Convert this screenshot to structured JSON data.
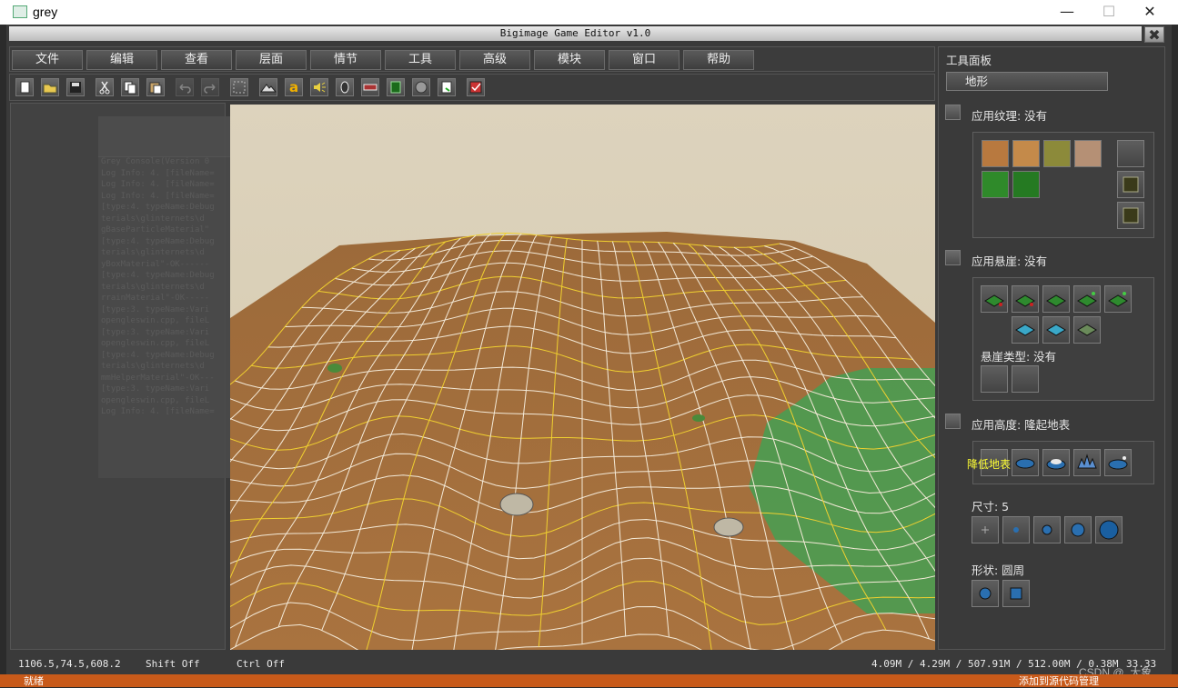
{
  "os_window": {
    "title": "grey",
    "minimize_glyph": "—",
    "maximize_glyph": "☐",
    "close_glyph": "✕"
  },
  "app": {
    "title": "Bigimage Game Editor v1.0",
    "close_glyph": "✖"
  },
  "menu": {
    "items": [
      "文件",
      "编辑",
      "查看",
      "层面",
      "情节",
      "工具",
      "高级",
      "模块",
      "窗口",
      "帮助"
    ]
  },
  "toolbar": {
    "icons": [
      "new-file-icon",
      "open-folder-icon",
      "save-icon",
      "cut-icon",
      "copy-icon",
      "paste-icon",
      "undo-icon",
      "redo-icon",
      "select-icon",
      "terrain-tool-icon",
      "text-tool-icon",
      "sound-icon",
      "unit-icon",
      "doodad-icon",
      "region-icon",
      "camera-icon",
      "export-icon",
      "test-map-icon"
    ],
    "text_tool_glyph": "a"
  },
  "console": {
    "lines": [
      "Grey Console(Version 0",
      "Log Info: 4. [fileName=",
      "Log Info: 4. [fileName=",
      "Log Info: 4. [fileName=",
      "[type:4. typeName:Debug",
      "terials\\glinternets\\d",
      "gBaseParticleMaterial\"",
      "[type:4. typeName:Debug",
      "terials\\glinternets\\d",
      "yBoxMaterial\"-OK------",
      "[type:4. typeName:Debug",
      "terials\\glinternets\\d",
      "rrainMaterial\"-OK-----",
      "[type:3. typeName:Vari",
      "opengleswin.cpp, fileL",
      "[type:3. typeName:Vari",
      "opengleswin.cpp, fileL",
      "[type:4. typeName:Debug",
      "terials\\glinternets\\d",
      "mmHelperMaterial\"-OK---",
      "[type:3. typeName:Vari",
      "opengleswin.cpp, fileL",
      "Log Info: 4. [fileName="
    ]
  },
  "panel": {
    "title": "工具面板",
    "terrain_button": "地形",
    "apply_texture": "应用纹理: 没有",
    "apply_cliff": "应用悬崖: 没有",
    "cliff_type": "悬崖类型: 没有",
    "apply_height": "应用高度: 隆起地表",
    "tooltip": "降低地表",
    "size": "尺寸: 5",
    "shape": "形状: 圆周",
    "texture_tiles": [
      "dirt",
      "dirt-light",
      "grass-dirt",
      "rocky-dirt",
      "grass",
      "grass-dark"
    ],
    "colors": {
      "dirt": "#b8793f",
      "dirt_light": "#c48a4a",
      "grass_dirt": "#8c8a3a",
      "rocky": "#b59075",
      "grass": "#2f8a2a",
      "grass_dark": "#257a22"
    }
  },
  "status": {
    "coords": "1106.5,74.5,608.2",
    "shift": "Shift Off",
    "ctrl": "Ctrl Off",
    "memory": "4.09M / 4.29M / 507.91M / 512.00M / 0.38M",
    "fps": "33.33"
  },
  "taskbar": {
    "left_text": "就绪",
    "right_text": "添加到源代码管理"
  },
  "watermark": "CSDN @_大象"
}
